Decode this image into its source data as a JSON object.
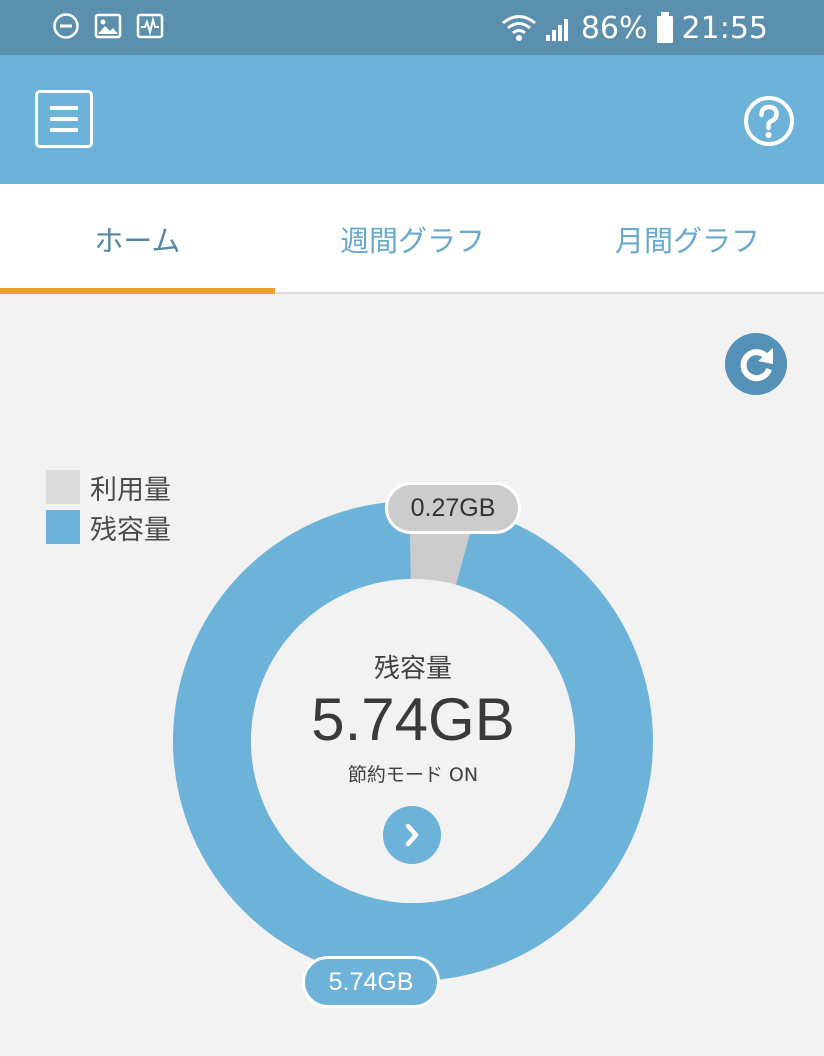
{
  "status_bar": {
    "battery": "86%",
    "time": "21:55",
    "icons": [
      "do-not-disturb-icon",
      "image-icon",
      "activity-icon",
      "wifi-icon",
      "signal-icon",
      "battery-icon"
    ]
  },
  "app_bar": {
    "menu_icon": "menu-icon",
    "help_icon": "help-icon"
  },
  "tabs": [
    {
      "label": "ホーム",
      "active": true
    },
    {
      "label": "週間グラフ",
      "active": false
    },
    {
      "label": "月間グラフ",
      "active": false
    }
  ],
  "legend": [
    {
      "label": "利用量",
      "color": "#dcdcdc"
    },
    {
      "label": "残容量",
      "color": "#6db3d9"
    }
  ],
  "summary": {
    "title": "残容量",
    "value": "5.74GB",
    "mode": "節約モード ON"
  },
  "chart_data": {
    "type": "pie",
    "labels": [
      "利用量",
      "残容量"
    ],
    "values": [
      0.27,
      5.74
    ],
    "unit": "GB",
    "value_labels": [
      "0.27GB",
      "5.74GB"
    ],
    "colors": [
      "#cccccc",
      "#6db3d9"
    ]
  },
  "colors": {
    "status_bar": "#5b8fae",
    "app_bar": "#6db3d9",
    "tab_indicator": "#e8a237",
    "used": "#cccccc",
    "remaining": "#6db3d9"
  }
}
